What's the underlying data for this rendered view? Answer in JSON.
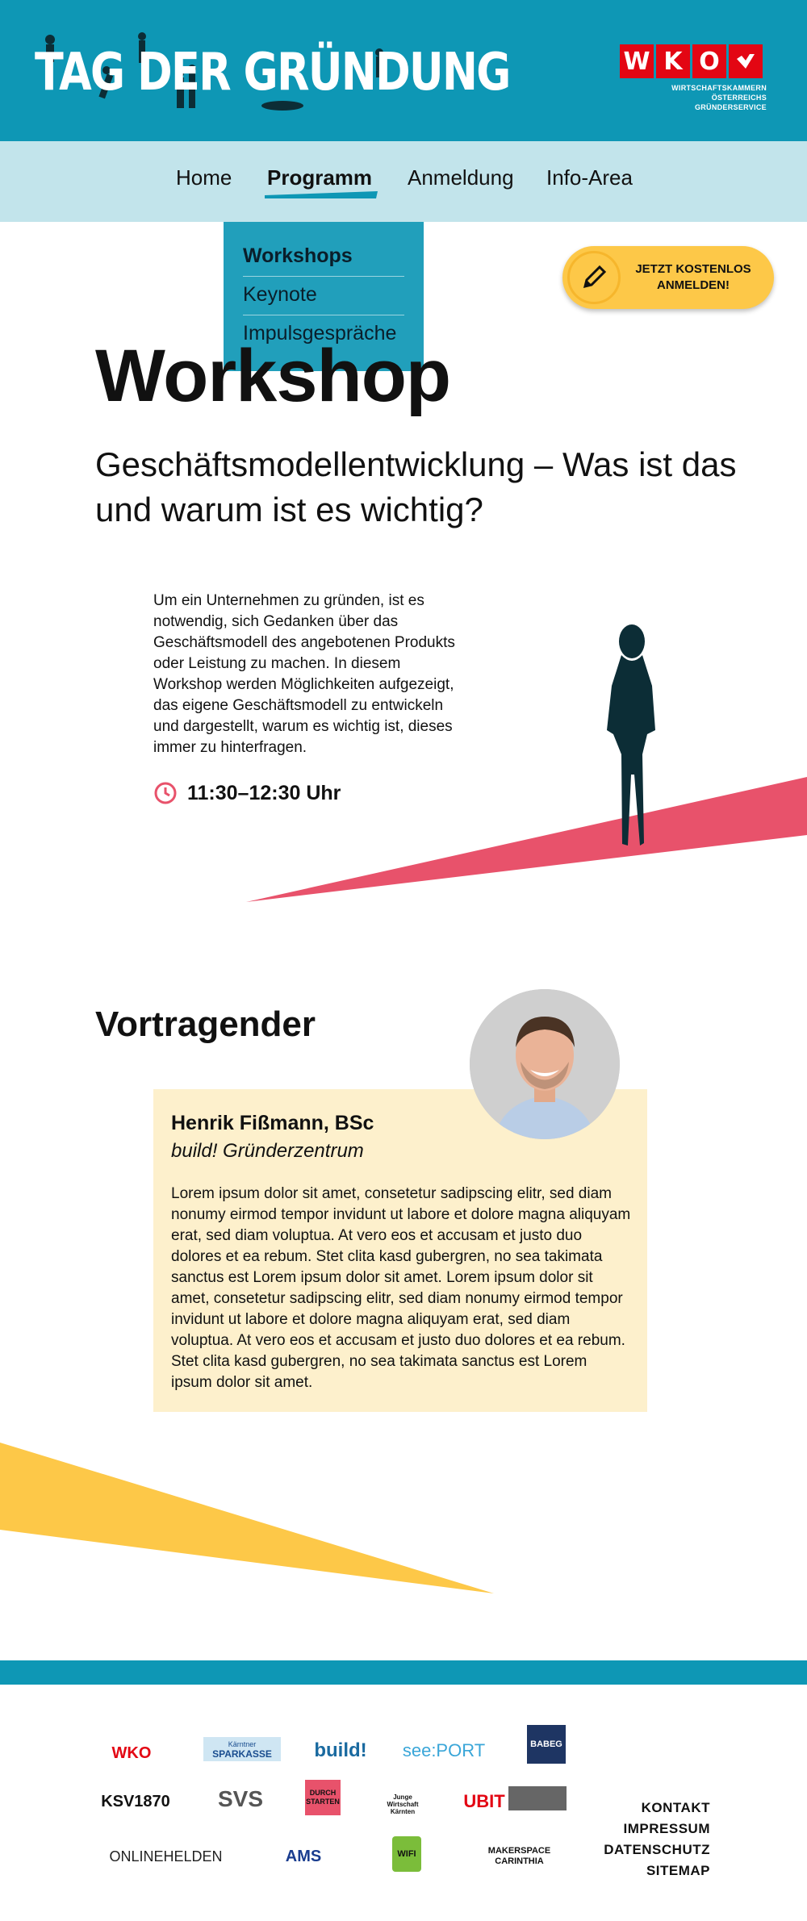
{
  "header": {
    "title": "TAG DER GRÜNDUNG",
    "wko": {
      "letters": [
        "W",
        "K",
        "O"
      ],
      "line1": "WIRTSCHAFTSKAMMERN ÖSTERREICHS",
      "line2": "GRÜNDERSERVICE"
    }
  },
  "nav": {
    "items": [
      {
        "label": "Home"
      },
      {
        "label": "Programm"
      },
      {
        "label": "Anmeldung"
      },
      {
        "label": "Info-Area"
      }
    ],
    "dropdown": [
      "Workshops",
      "Keynote",
      "Impulsgespräche"
    ]
  },
  "cta": {
    "label": "JETZT KOSTENLOS ANMELDEN!"
  },
  "page": {
    "title": "Workshop",
    "subtitle": "Geschäftsmodellentwicklung – Was ist das und warum ist es wichtig?",
    "description": "Um ein Unternehmen zu gründen, ist es notwendig, sich Gedanken über das Geschäftsmodell des angebotenen Produkts oder Leistung zu machen. In diesem Workshop werden Möglichkeiten aufgezeigt, das eigene Geschäftsmodell zu entwickeln und dargestellt, warum es wichtig ist, dieses immer zu hinterfragen.",
    "time": "11:30–12:30 Uhr"
  },
  "speaker": {
    "section_title": "Vortragender",
    "name": "Henrik Fißmann, BSc",
    "organization": "build! Gründerzentrum",
    "bio": "Lorem ipsum dolor sit amet, consetetur sadipscing elitr, sed diam nonumy eirmod tempor invidunt ut labore et dolore magna aliquyam erat, sed diam voluptua. At vero eos et accusam et justo duo dolores et ea rebum. Stet clita kasd gubergren, no sea takimata sanctus est Lorem ipsum dolor sit amet. Lorem ipsum dolor sit amet, consetetur sadipscing elitr, sed diam nonumy eirmod tempor invidunt ut labore et dolore magna aliquyam erat, sed diam voluptua. At vero eos et accusam et justo duo dolores et ea rebum. Stet clita kasd gubergren, no sea takimata sanctus est Lorem ipsum dolor sit amet."
  },
  "footer": {
    "logos": {
      "wko": "WKO",
      "sparkasse_top": "Kärntner",
      "sparkasse": "SPARKASSE",
      "build": "build!",
      "seaport": "see:PORT",
      "babeg": "BABEG",
      "ksv": "KSV1870",
      "svs": "SVS",
      "durch_starten": "DURCH STARTEN",
      "jw": "Junge Wirtschaft Kärnten",
      "ubit": "UBIT",
      "onlinehelden": "ONLINEHELDEN",
      "ams": "AMS",
      "wifi": "WIFI",
      "makerspace": "MAKERSPACE CARINTHIA"
    },
    "links": [
      "KONTAKT",
      "IMPRESSUM",
      "DATENSCHUTZ",
      "SITEMAP"
    ]
  },
  "colors": {
    "header_bg": "#0e97b5",
    "nav_bg": "#c2e4eb",
    "accent_pink": "#e8526b",
    "accent_yellow": "#fdc848",
    "card_bg": "#fdf0cc",
    "wko_red": "#e30613"
  }
}
